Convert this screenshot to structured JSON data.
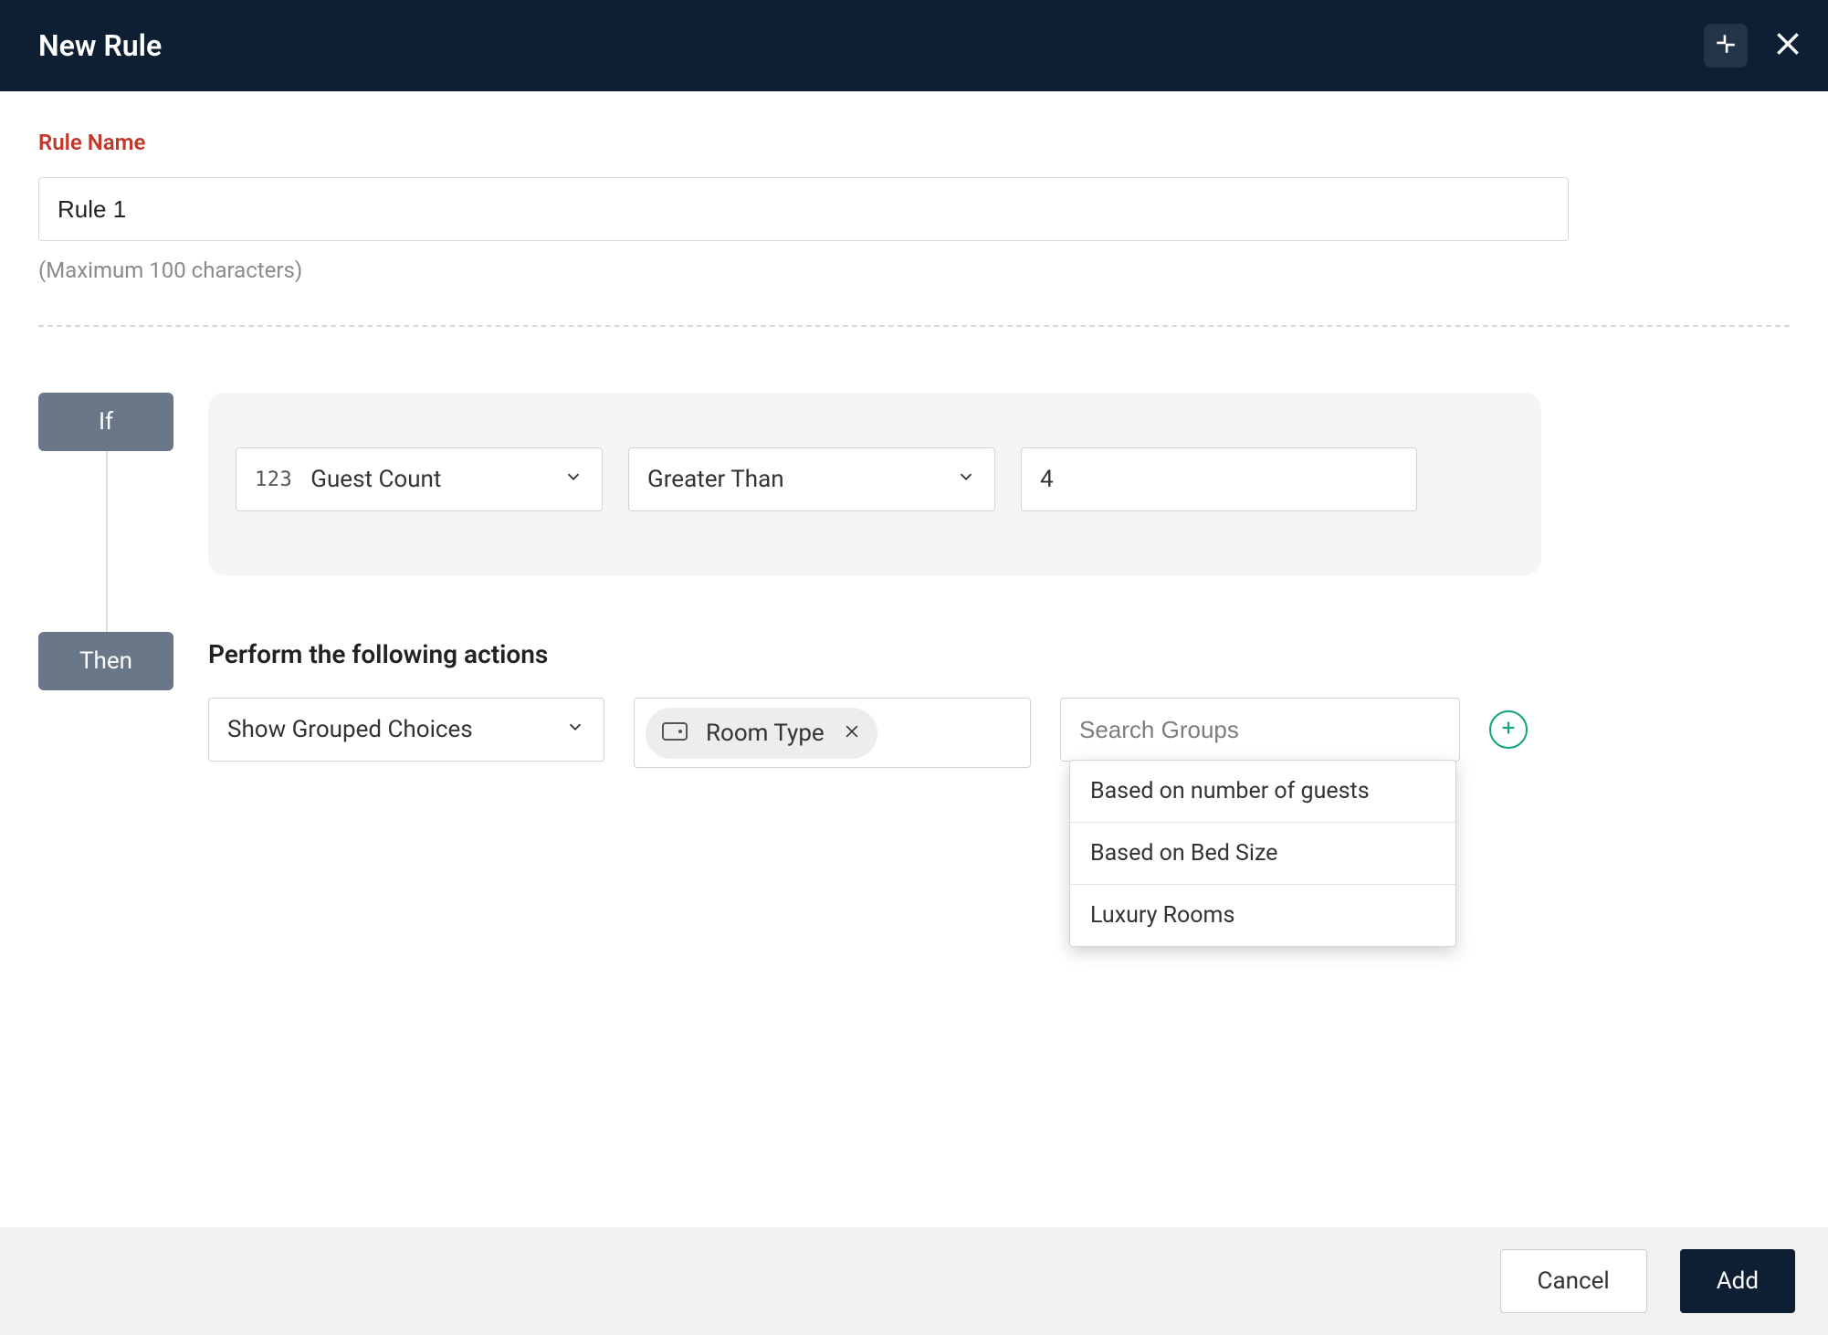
{
  "header": {
    "title": "New Rule"
  },
  "rule_name": {
    "label": "Rule Name",
    "value": "Rule 1",
    "hint": "(Maximum 100 characters)"
  },
  "badges": {
    "if": "If",
    "then": "Then"
  },
  "condition": {
    "field_label": "Guest Count",
    "operator_label": "Greater Than",
    "value": "4"
  },
  "then": {
    "title": "Perform the following actions",
    "action_label": "Show Grouped Choices",
    "chip_label": "Room Type",
    "search_placeholder": "Search Groups",
    "dropdown_options": [
      "Based on number of guests",
      "Based on Bed Size",
      "Luxury Rooms"
    ]
  },
  "footer": {
    "cancel": "Cancel",
    "add": "Add"
  }
}
